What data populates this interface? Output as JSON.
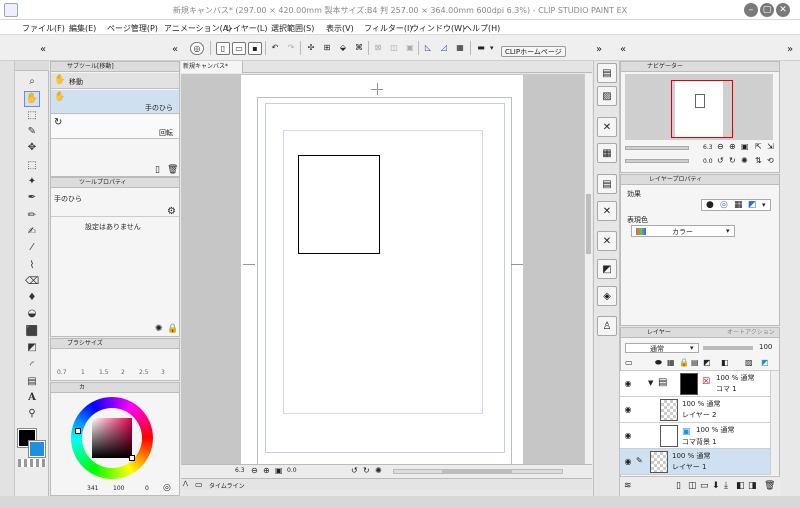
{
  "app": {
    "window_title": "新規キャンバス* (297.00 × 420.00mm 製本サイズ:B4 判 257.00 × 364.00mm 600dpi 6.3%) - CLIP STUDIO PAINT EX",
    "minimize": "–",
    "maximize": "▢",
    "close": "✕"
  },
  "menu": [
    "ファイル(F)",
    "編集(E)",
    "ページ管理(P)",
    "アニメーション(A)",
    "レイヤー(L)",
    "選択範囲(S)",
    "表示(V)",
    "フィルター(I)",
    "ウィンドウ(W)",
    "ヘルプ(H)"
  ],
  "toolbar": {
    "home_button": "CLIPホームページ"
  },
  "subtool": {
    "tab": "サブツール[移動]",
    "group": "移動",
    "items": [
      "手のひら",
      "回転"
    ]
  },
  "tool_property": {
    "tab": "ツールプロパティ",
    "tool_name": "手のひら",
    "message": "設定はありません"
  },
  "brush_size": {
    "tab": "ブラシサイズ",
    "sizes": [
      "0.7",
      "1",
      "1.5",
      "2",
      "2.5",
      "3"
    ]
  },
  "color": {
    "tab": "カ",
    "values": [
      "341",
      "100",
      "0"
    ],
    "main_color": "#000000",
    "sub_color": "#1e90e0"
  },
  "canvas": {
    "tab": "新規キャンバス*",
    "zoom": "6.3",
    "angle": "0.0",
    "timeline_tab": "タイムライン"
  },
  "navigator": {
    "tab": "ナビゲーター",
    "zoom": "6.3",
    "angle": "0.0"
  },
  "layer_property": {
    "tab": "レイヤープロパティ",
    "effect_label": "効果",
    "expression_color_label": "表現色",
    "expression_color_value": "カラー"
  },
  "layers": {
    "tabs": [
      "レイヤー",
      "オートアクション"
    ],
    "blend_mode": "通常",
    "opacity": "100",
    "rows": [
      {
        "opacity_mode": "100 % 通常",
        "name": "コマ 1"
      },
      {
        "opacity_mode": "100 % 通常",
        "name": "レイヤー 2"
      },
      {
        "opacity_mode": "100 % 通常",
        "name": "コマ背景 1"
      },
      {
        "opacity_mode": "100 % 通常",
        "name": "レイヤー 1"
      }
    ]
  }
}
